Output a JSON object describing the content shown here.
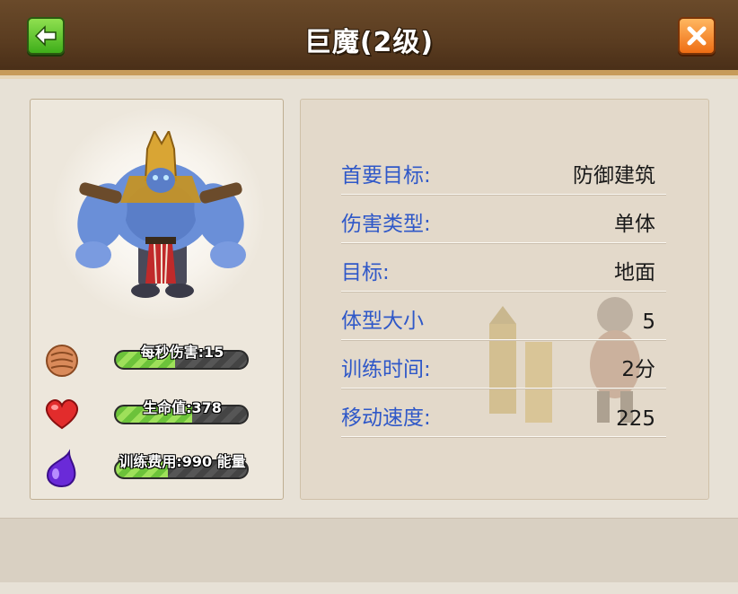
{
  "header": {
    "title": "巨魔(2级)"
  },
  "stats": [
    {
      "label": "每秒伤害:15",
      "icon": "fist-icon",
      "fill_percent": 45
    },
    {
      "label": "生命值:378",
      "icon": "heart-icon",
      "fill_percent": 58
    },
    {
      "label": "训练费用:990 能量",
      "icon": "energy-drop-icon",
      "fill_percent": 40
    }
  ],
  "info": [
    {
      "key": "首要目标:",
      "value": "防御建筑"
    },
    {
      "key": "伤害类型:",
      "value": "单体"
    },
    {
      "key": "目标:",
      "value": "地面"
    },
    {
      "key": "体型大小",
      "value": "5"
    },
    {
      "key": "训练时间:",
      "value": "2分"
    },
    {
      "key": "移动速度:",
      "value": "225"
    }
  ],
  "colors": {
    "key_text": "#2f58c8",
    "header_bg": "#5a3c20",
    "back_button": "#3fae1a",
    "close_button": "#ee6d14"
  }
}
